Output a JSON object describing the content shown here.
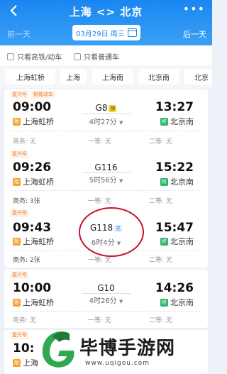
{
  "header": {
    "title": "上海 <> 北京",
    "more": "•••",
    "prev_day": "前一天",
    "next_day": "后一天",
    "date": "03月29日 周三"
  },
  "filters": [
    {
      "label": "只看高铁/动车"
    },
    {
      "label": "只看普通车"
    }
  ],
  "stations": [
    "上海虹桥",
    "上海",
    "上海南",
    "北京南",
    "北京"
  ],
  "trains": [
    {
      "badge": "复兴号",
      "badge2": "智能动车",
      "dep": "09:00",
      "from": "上海虹桥",
      "from_tag": "始",
      "no": "G8",
      "no_badge": "静",
      "dur": "4时27分",
      "arr": "13:27",
      "to": "北京南",
      "to_tag": "终",
      "seats": [
        "商务: 无",
        "一等: 无",
        "二等: 无"
      ]
    },
    {
      "badge": "复兴号",
      "dep": "09:26",
      "from": "上海虹桥",
      "from_tag": "始",
      "no": "G116",
      "dur": "5时56分",
      "arr": "15:22",
      "to": "北京南",
      "to_tag": "终",
      "seats": [
        "商务: 3张",
        "一等: 无",
        "二等: 无"
      ]
    },
    {
      "badge": "复兴号",
      "dep": "09:43",
      "from": "上海虹桥",
      "from_tag": "始",
      "no": "G118",
      "no_badge": "兑",
      "dur": "6时4分",
      "arr": "15:47",
      "to": "北京南",
      "to_tag": "终",
      "seats": [
        "商务: 2张",
        "一等: 无",
        "二等: 无"
      ]
    },
    {
      "badge": "复兴号",
      "dep": "10:00",
      "from": "上海虹桥",
      "from_tag": "始",
      "no": "G10",
      "dur": "4时26分",
      "arr": "14:26",
      "to": "北京南",
      "to_tag": "终",
      "seats": [
        "商务: 无",
        "一等: 无",
        "二等: 无"
      ]
    },
    {
      "badge": "复兴号",
      "dep": "10:",
      "from": "上海",
      "from_tag": "始"
    }
  ],
  "watermark": {
    "text": "毕博手游网",
    "url": "www.uqigou.com"
  },
  "colors": {
    "header_blue": "#1a86f0",
    "accent_orange": "#e67a2c",
    "annotation_red": "#c8102e"
  }
}
